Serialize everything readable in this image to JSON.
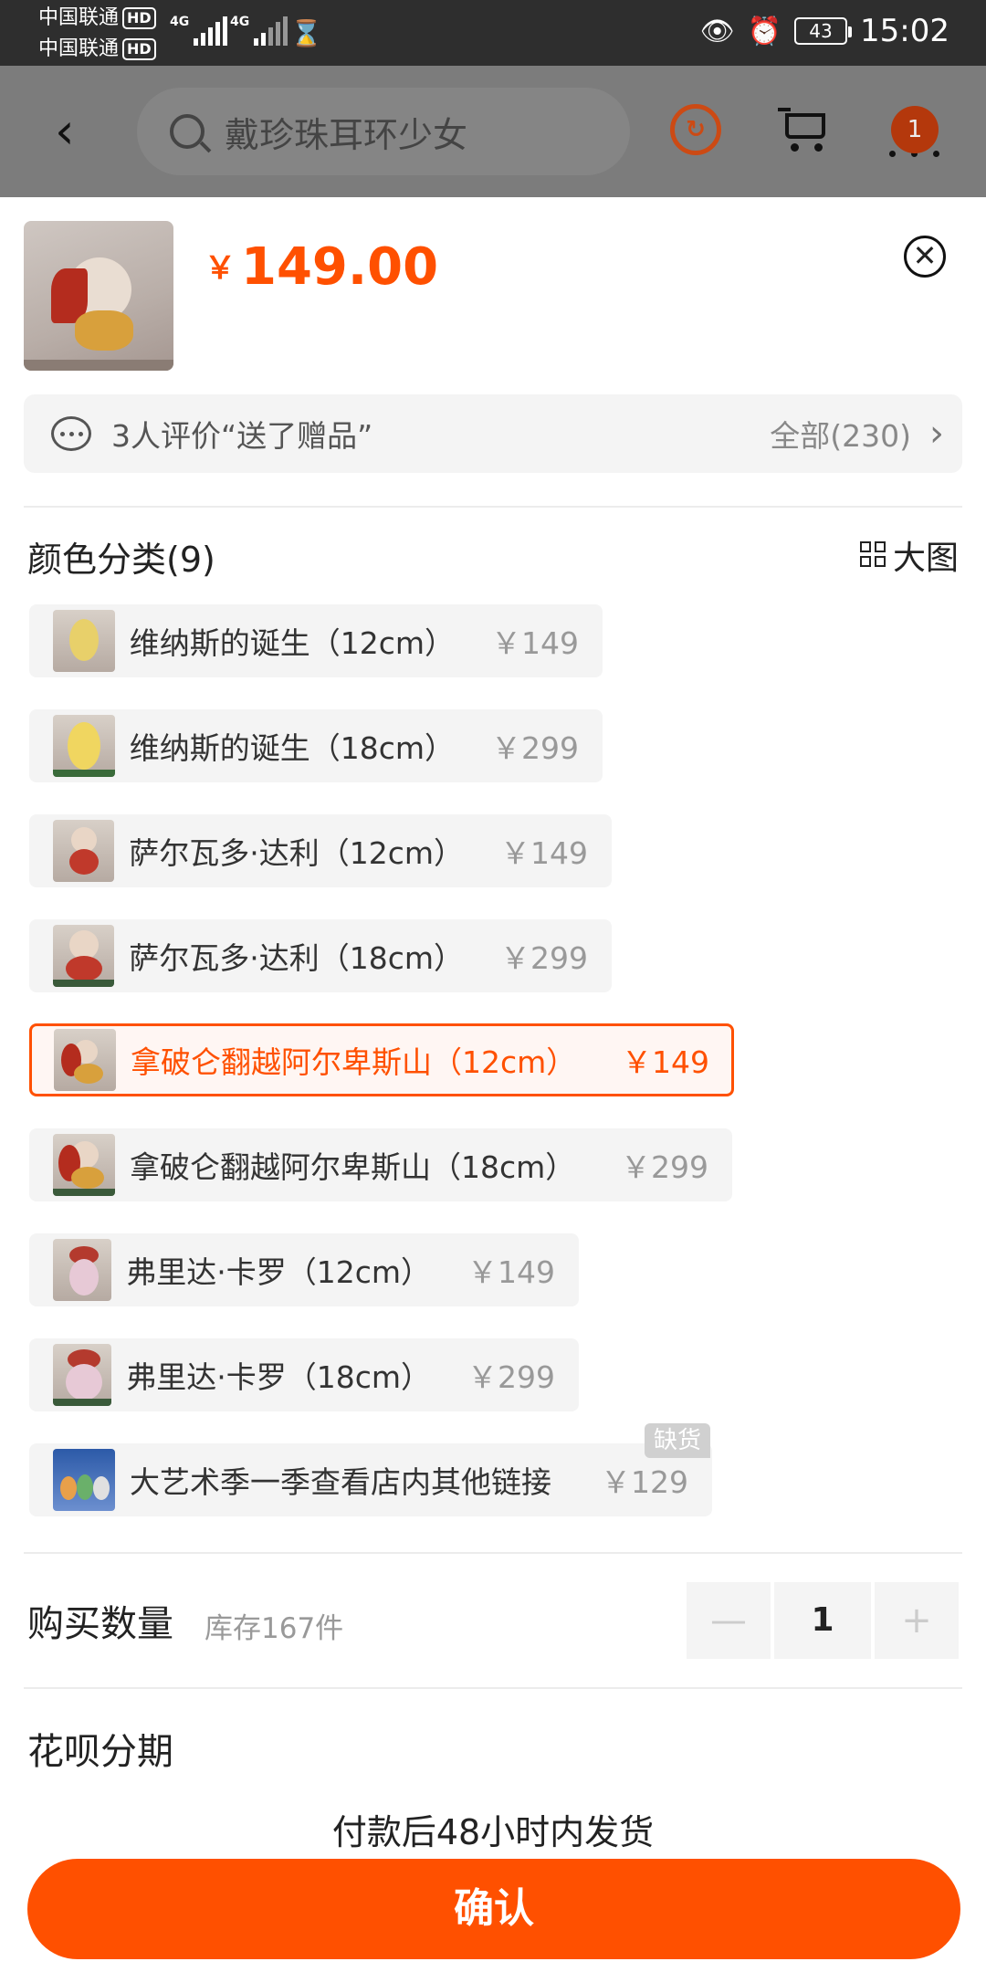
{
  "status_bar": {
    "carrier1": "中国联通",
    "carrier2": "中国联通",
    "hd": "HD",
    "network1": "4G",
    "network2": "4G",
    "battery": "43",
    "time": "15:02"
  },
  "header": {
    "search_text": "戴珍珠耳环少女",
    "cart_badge": "1"
  },
  "product": {
    "currency": "￥",
    "price": "149.00"
  },
  "review": {
    "summary": "3人评价“送了赠品”",
    "all": "全部(230)"
  },
  "category": {
    "title": "颜色分类(9)",
    "big_image": "大图",
    "options": [
      {
        "name": "维纳斯的诞生（12cm）",
        "price": "￥149"
      },
      {
        "name": "维纳斯的诞生（18cm）",
        "price": "￥299"
      },
      {
        "name": "萨尔瓦多·达利（12cm）",
        "price": "￥149"
      },
      {
        "name": "萨尔瓦多·达利（18cm）",
        "price": "￥299"
      },
      {
        "name": "拿破仑翻越阿尔卑斯山（12cm）",
        "price": "￥149"
      },
      {
        "name": "拿破仑翻越阿尔卑斯山（18cm）",
        "price": "￥299"
      },
      {
        "name": "弗里达·卡罗（12cm）",
        "price": "￥149"
      },
      {
        "name": "弗里达·卡罗（18cm）",
        "price": "￥299"
      },
      {
        "name": "大艺术季一季查看店内其他链接",
        "price": "￥129",
        "badge": "缺货"
      }
    ],
    "selected_index": 4
  },
  "quantity": {
    "label": "购买数量",
    "stock": "库存167件",
    "value": "1",
    "minus": "—",
    "plus": "+"
  },
  "installment": {
    "label": "花呗分期"
  },
  "shipping": {
    "text": "付款后48小时内发货"
  },
  "confirm": {
    "label": "确认"
  },
  "colors": {
    "accent": "#ff5000",
    "header_dim": "#7c7c7c"
  }
}
